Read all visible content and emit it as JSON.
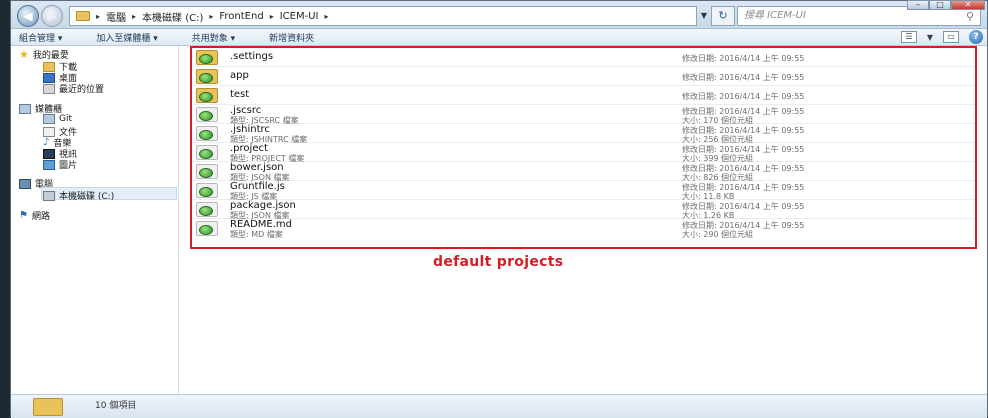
{
  "address": {
    "crumbs": [
      "電腦",
      "本機磁碟 (C:)",
      "FrontEnd",
      "ICEM-UI"
    ],
    "separator": "▸",
    "search_placeholder": "搜尋 ICEM-UI"
  },
  "toolbar": {
    "items": [
      "組合管理 ▾",
      "加入至媒體櫃 ▾",
      "共用對象 ▾",
      "新增資料夾"
    ]
  },
  "nav": {
    "favorites": {
      "label": "我的最愛",
      "items": [
        "下載",
        "桌面",
        "最近的位置"
      ]
    },
    "libraries": {
      "label": "媒體櫃",
      "items": [
        "Git",
        "文件",
        "音樂",
        "視訊",
        "圖片"
      ]
    },
    "computer": {
      "label": "電腦",
      "items": [
        "本機磁碟 (C:)"
      ]
    },
    "network": {
      "label": "網路"
    }
  },
  "files": [
    {
      "name": ".settings",
      "type": "",
      "date": "修改日期: 2016/4/14 上午 09:55",
      "size": "",
      "folder": true
    },
    {
      "name": "app",
      "type": "",
      "date": "修改日期: 2016/4/14 上午 09:55",
      "size": "",
      "folder": true
    },
    {
      "name": "test",
      "type": "",
      "date": "修改日期: 2016/4/14 上午 09:55",
      "size": "",
      "folder": true
    },
    {
      "name": ".jscsrc",
      "type": "類型: JSCSRC 檔案",
      "date": "修改日期: 2016/4/14 上午 09:55",
      "size": "大小: 170 個位元組"
    },
    {
      "name": ".jshintrc",
      "type": "類型: JSHINTRC 檔案",
      "date": "修改日期: 2016/4/14 上午 09:55",
      "size": "大小: 256 個位元組"
    },
    {
      "name": ".project",
      "type": "類型: PROJECT 檔案",
      "date": "修改日期: 2016/4/14 上午 09:55",
      "size": "大小: 399 個位元組"
    },
    {
      "name": "bower.json",
      "type": "類型: JSON 檔案",
      "date": "修改日期: 2016/4/14 上午 09:55",
      "size": "大小: 826 個位元組"
    },
    {
      "name": "Gruntfile.js",
      "type": "類型: JS 檔案",
      "date": "修改日期: 2016/4/14 上午 09:55",
      "size": "大小: 11.8 KB"
    },
    {
      "name": "package.json",
      "type": "類型: JSON 檔案",
      "date": "修改日期: 2016/4/14 上午 09:55",
      "size": "大小: 1.26 KB"
    },
    {
      "name": "README.md",
      "type": "類型: MD 檔案",
      "date": "修改日期: 2016/4/14 上午 09:55",
      "size": "大小: 290 個位元組"
    }
  ],
  "annotation": "default projects",
  "status": {
    "count": "10 個項目"
  },
  "colors": {
    "highlight": "#d21f26",
    "titlebar": "#c8d9ea"
  }
}
